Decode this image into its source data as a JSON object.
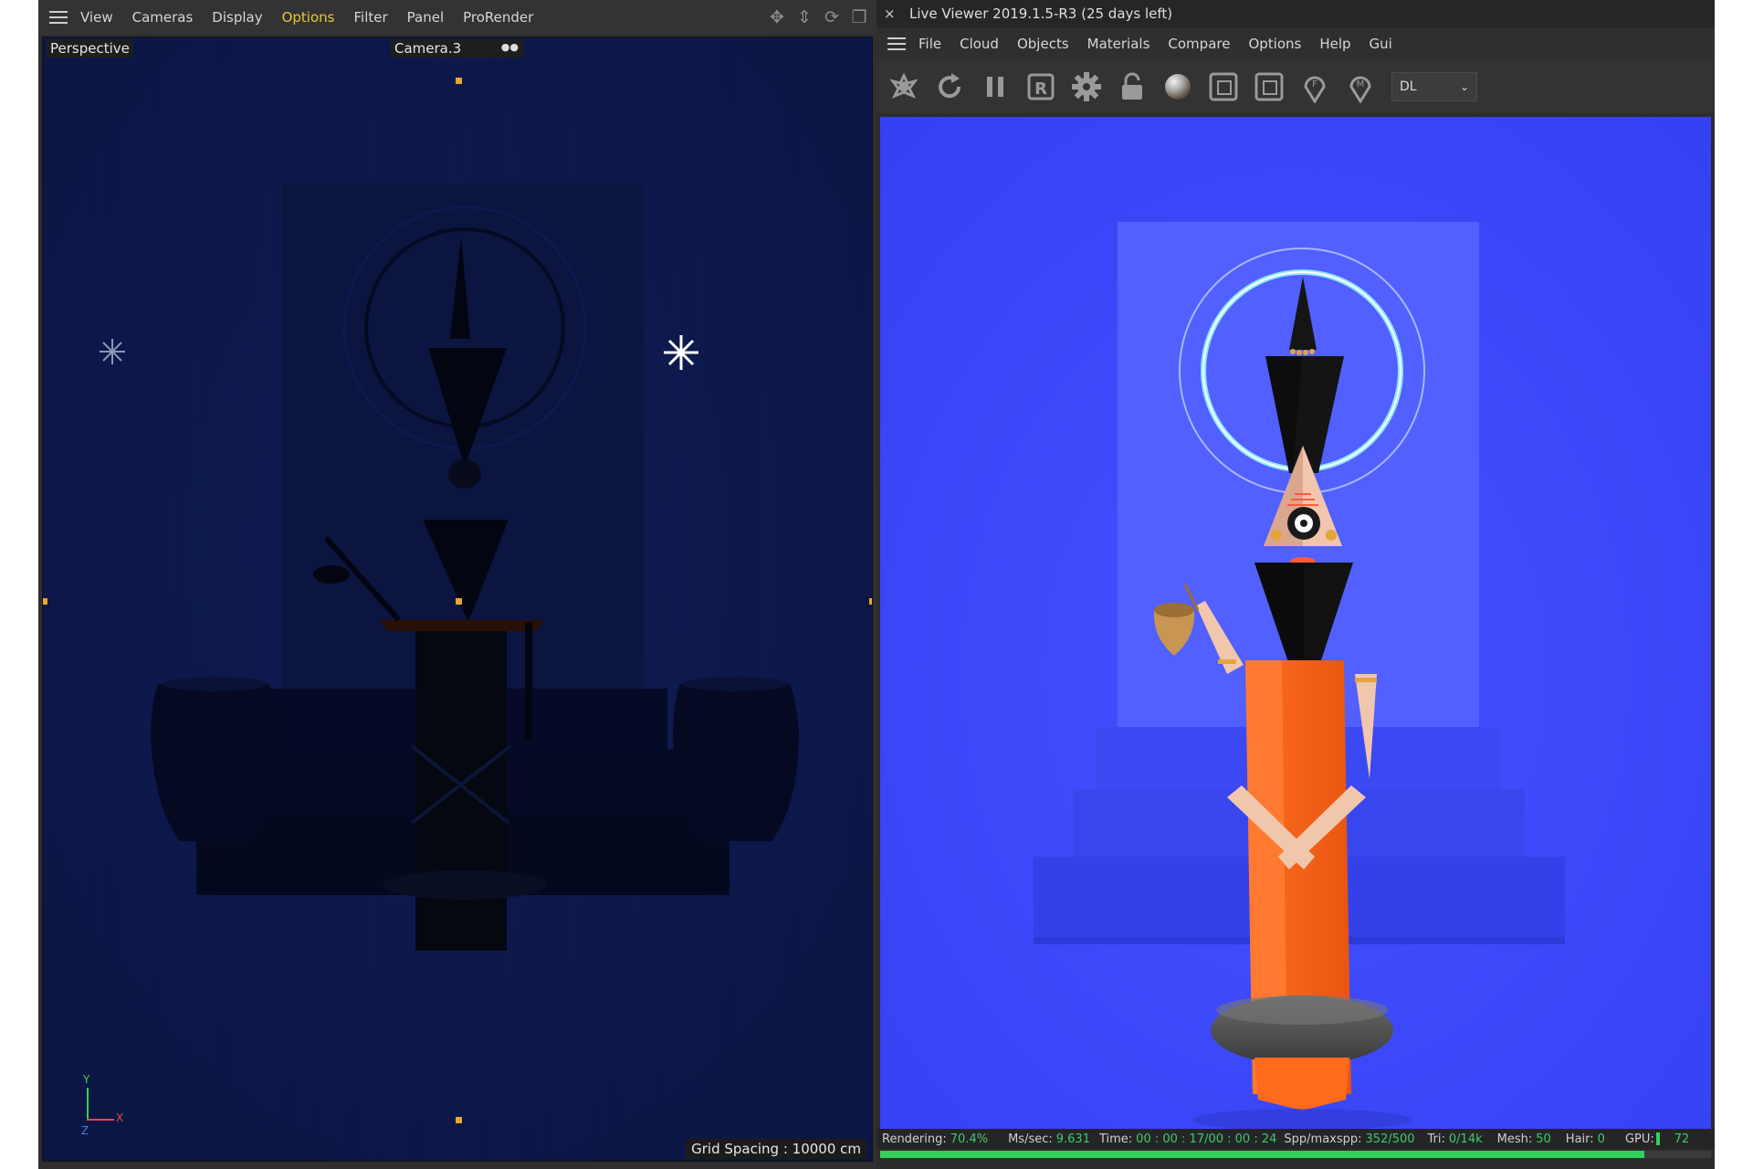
{
  "left_viewport": {
    "menu": [
      "View",
      "Cameras",
      "Display",
      "Options",
      "Filter",
      "Panel",
      "ProRender"
    ],
    "active_menu": "Options",
    "nav_icons": [
      "move-view-icon",
      "pan-view-icon",
      "rotate-view-icon",
      "toggle-layout-icon"
    ],
    "view_label": "Perspective",
    "camera_label": "Camera.3",
    "grid_spacing": "Grid Spacing : 10000 cm",
    "axis": {
      "y": "Y",
      "x": "X",
      "z": "Z"
    }
  },
  "live_viewer": {
    "close_glyph": "×",
    "title": "Live Viewer 2019.1.5-R3 (25 days left)",
    "menu": [
      "File",
      "Cloud",
      "Objects",
      "Materials",
      "Compare",
      "Options",
      "Help",
      "Gui"
    ],
    "toolbar_icons": [
      "send-scene-icon",
      "restart-render-icon",
      "pause-icon",
      "r-region-icon",
      "settings-gear-icon",
      "lock-icon",
      "material-ball-icon",
      "frame-region-icon",
      "frame-region-alt-icon",
      "pin-f-icon",
      "pin-m-icon"
    ],
    "kernel_select": "DL",
    "status": {
      "rendering_label": "Rendering:",
      "rendering_value": "70.4%",
      "ms_label": "Ms/sec:",
      "ms_value": "9.631",
      "time_label": "Time:",
      "time_value": "00 : 00 : 17/00 : 00 : 24",
      "spp_label": "Spp/maxspp:",
      "spp_value": "352/500",
      "tri_label": "Tri:",
      "tri_value": "0/14k",
      "mesh_label": "Mesh:",
      "mesh_value": "50",
      "hair_label": "Hair:",
      "hair_value": "0",
      "gpu_label": "GPU:",
      "gpu_value": "72"
    },
    "progress": 0.92
  },
  "colors": {
    "viewport_bg": "#0c1748",
    "render_bg": "#3b49ff",
    "accent_orange": "#ff6a1c",
    "active_menu": "#f0c23a",
    "status_green": "#31d15c"
  }
}
